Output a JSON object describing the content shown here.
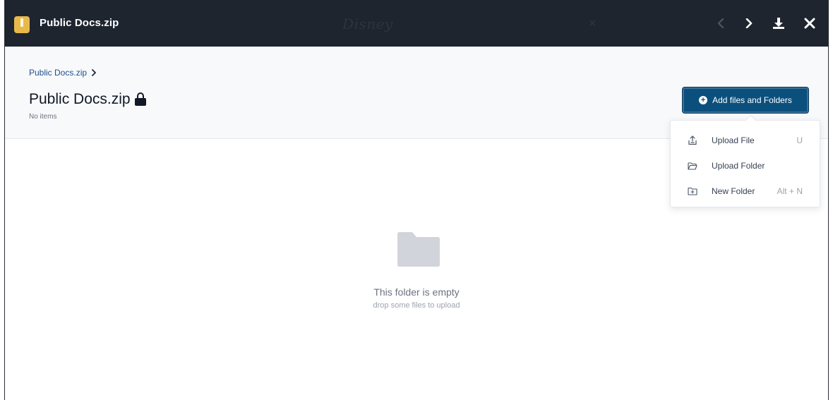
{
  "topbar": {
    "file_name": "Public Docs.zip",
    "file_icon": "zip-file-icon",
    "watermark_text": "Disney",
    "prev_icon": "chevron-left-icon",
    "next_icon": "chevron-right-icon",
    "download_icon": "download-icon",
    "close_icon": "close-icon"
  },
  "header": {
    "breadcrumb": [
      "Public Docs.zip"
    ],
    "title": "Public Docs.zip",
    "title_icon": "lock-icon",
    "item_count": "No items",
    "add_button_label": "Add files and Folders"
  },
  "dropdown": {
    "items": [
      {
        "label": "Upload File",
        "shortcut": "U",
        "icon": "upload-file-icon"
      },
      {
        "label": "Upload Folder",
        "shortcut": "",
        "icon": "folder-open-icon"
      },
      {
        "label": "New Folder",
        "shortcut": "Alt + N",
        "icon": "new-folder-icon"
      }
    ]
  },
  "empty_state": {
    "title": "This folder is empty",
    "subtitle": "drop some files to upload",
    "icon": "folder-icon"
  },
  "colors": {
    "topbar_bg": "#1e252f",
    "accent": "#0b4f7d",
    "zip_icon": "#e8b94a",
    "header_bg": "#f8f9fb"
  }
}
